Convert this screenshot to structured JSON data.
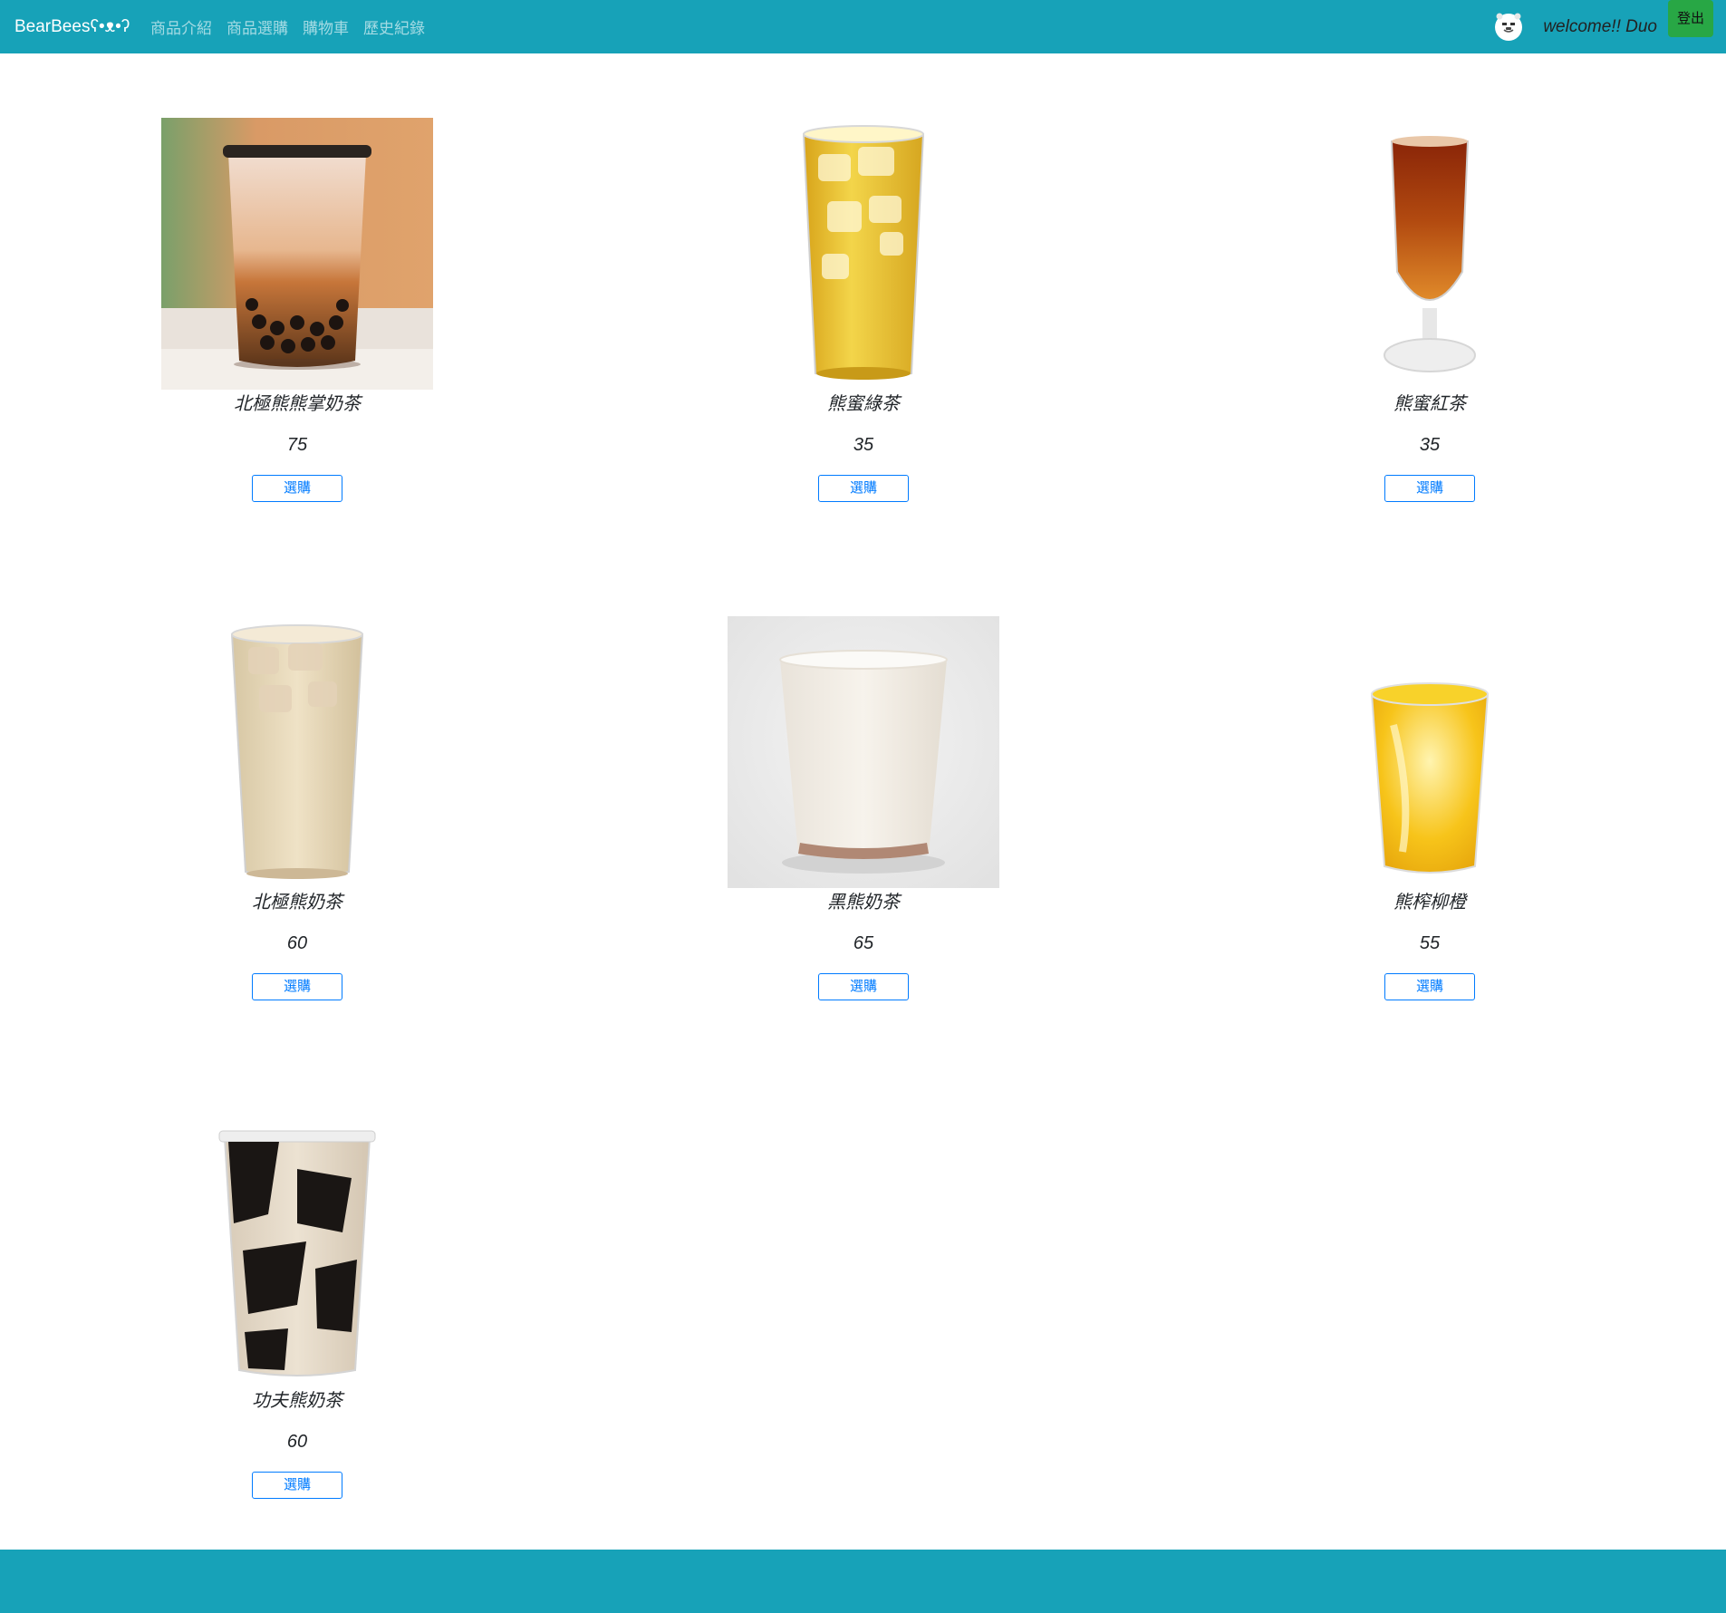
{
  "navbar": {
    "brand": "BearBeesʕ•ᴥ•ʔ",
    "links": [
      "商品介紹",
      "商品選購",
      "購物車",
      "歷史紀錄"
    ],
    "welcome": "welcome!! Duo",
    "logout": "登出"
  },
  "products": [
    {
      "name": "北極熊熊掌奶茶",
      "price": "75",
      "button": "選購",
      "icon": "bubble-milk-tea-photo"
    },
    {
      "name": "熊蜜綠茶",
      "price": "35",
      "button": "選購",
      "icon": "iced-green-tea-photo"
    },
    {
      "name": "熊蜜紅茶",
      "price": "35",
      "button": "選購",
      "icon": "iced-black-tea-photo"
    },
    {
      "name": "北極熊奶茶",
      "price": "60",
      "button": "選購",
      "icon": "iced-milk-tea-photo"
    },
    {
      "name": "黑熊奶茶",
      "price": "65",
      "button": "選購",
      "icon": "milk-tea-cup-photo"
    },
    {
      "name": "熊榨柳橙",
      "price": "55",
      "button": "選購",
      "icon": "orange-juice-photo"
    },
    {
      "name": "功夫熊奶茶",
      "price": "60",
      "button": "選購",
      "icon": "grass-jelly-milk-tea-photo"
    }
  ],
  "colors": {
    "navbar": "#17a2b8",
    "logout": "#28a745",
    "button_outline": "#007bff"
  }
}
